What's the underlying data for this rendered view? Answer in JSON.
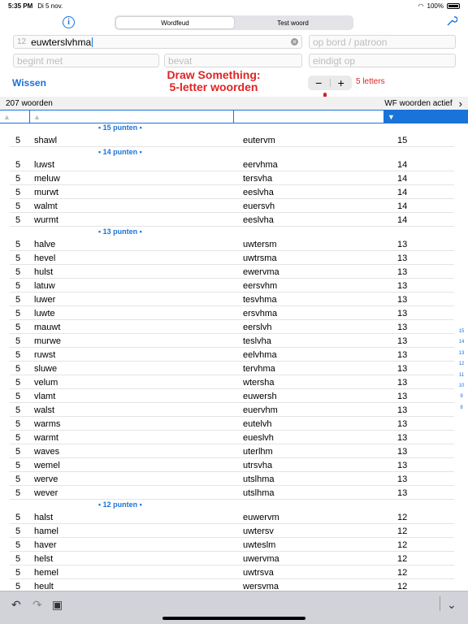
{
  "status": {
    "time": "5:35 PM",
    "date": "Di 5 nov.",
    "battery": "100%"
  },
  "tabs": [
    {
      "label": "Wordfeud",
      "active": true
    },
    {
      "label": "Test woord",
      "active": false
    }
  ],
  "search": {
    "count": "12",
    "value": "euwterslvhma"
  },
  "fields": {
    "bord": "op bord / patroon",
    "begint": "begint met",
    "bevat": "bevat",
    "eindigt": "eindigt op"
  },
  "wissen": "Wissen",
  "promo": {
    "line1": "Draw Something:",
    "line2": "5-letter woorden"
  },
  "stepper": {
    "minus": "−",
    "plus": "+"
  },
  "letters": "5 letters",
  "summary": {
    "count": "207 woorden",
    "wf": "WF woorden actief"
  },
  "groups": [
    {
      "header": "• 15 punten •",
      "rows": [
        {
          "len": "5",
          "word": "shawl",
          "rack": "eutervm",
          "pts": "15"
        }
      ]
    },
    {
      "header": "• 14 punten •",
      "rows": [
        {
          "len": "5",
          "word": "luwst",
          "rack": "eervhma",
          "pts": "14"
        },
        {
          "len": "5",
          "word": "meluw",
          "rack": "tersvha",
          "pts": "14"
        },
        {
          "len": "5",
          "word": "murwt",
          "rack": "eeslvha",
          "pts": "14"
        },
        {
          "len": "5",
          "word": "walmt",
          "rack": "euersvh",
          "pts": "14"
        },
        {
          "len": "5",
          "word": "wurmt",
          "rack": "eeslvha",
          "pts": "14"
        }
      ]
    },
    {
      "header": "• 13 punten •",
      "rows": [
        {
          "len": "5",
          "word": "halve",
          "rack": "uwtersm",
          "pts": "13"
        },
        {
          "len": "5",
          "word": "hevel",
          "rack": "uwtrsma",
          "pts": "13"
        },
        {
          "len": "5",
          "word": "hulst",
          "rack": "ewervma",
          "pts": "13"
        },
        {
          "len": "5",
          "word": "latuw",
          "rack": "eersvhm",
          "pts": "13"
        },
        {
          "len": "5",
          "word": "luwer",
          "rack": "tesvhma",
          "pts": "13"
        },
        {
          "len": "5",
          "word": "luwte",
          "rack": "ersvhma",
          "pts": "13"
        },
        {
          "len": "5",
          "word": "mauwt",
          "rack": "eerslvh",
          "pts": "13"
        },
        {
          "len": "5",
          "word": "murwe",
          "rack": "teslvha",
          "pts": "13"
        },
        {
          "len": "5",
          "word": "ruwst",
          "rack": "eelvhma",
          "pts": "13"
        },
        {
          "len": "5",
          "word": "sluwe",
          "rack": "tervhma",
          "pts": "13"
        },
        {
          "len": "5",
          "word": "velum",
          "rack": "wtersha",
          "pts": "13"
        },
        {
          "len": "5",
          "word": "vlamt",
          "rack": "euwersh",
          "pts": "13"
        },
        {
          "len": "5",
          "word": "walst",
          "rack": "euervhm",
          "pts": "13"
        },
        {
          "len": "5",
          "word": "warms",
          "rack": "eutelvh",
          "pts": "13"
        },
        {
          "len": "5",
          "word": "warmt",
          "rack": "eueslvh",
          "pts": "13"
        },
        {
          "len": "5",
          "word": "waves",
          "rack": "uterlhm",
          "pts": "13"
        },
        {
          "len": "5",
          "word": "wemel",
          "rack": "utrsvha",
          "pts": "13"
        },
        {
          "len": "5",
          "word": "werve",
          "rack": "utslhma",
          "pts": "13"
        },
        {
          "len": "5",
          "word": "wever",
          "rack": "utslhma",
          "pts": "13"
        }
      ]
    },
    {
      "header": "• 12 punten •",
      "rows": [
        {
          "len": "5",
          "word": "halst",
          "rack": "euwervm",
          "pts": "12"
        },
        {
          "len": "5",
          "word": "hamel",
          "rack": "uwtersv",
          "pts": "12"
        },
        {
          "len": "5",
          "word": "haver",
          "rack": "uwteslm",
          "pts": "12"
        },
        {
          "len": "5",
          "word": "helst",
          "rack": "uwervma",
          "pts": "12"
        },
        {
          "len": "5",
          "word": "hemel",
          "rack": "uwtrsva",
          "pts": "12"
        },
        {
          "len": "5",
          "word": "heult",
          "rack": "wersvma",
          "pts": "12"
        }
      ]
    }
  ],
  "index": [
    "15",
    "14",
    "13",
    "12",
    "11",
    "10",
    "9",
    "8"
  ]
}
